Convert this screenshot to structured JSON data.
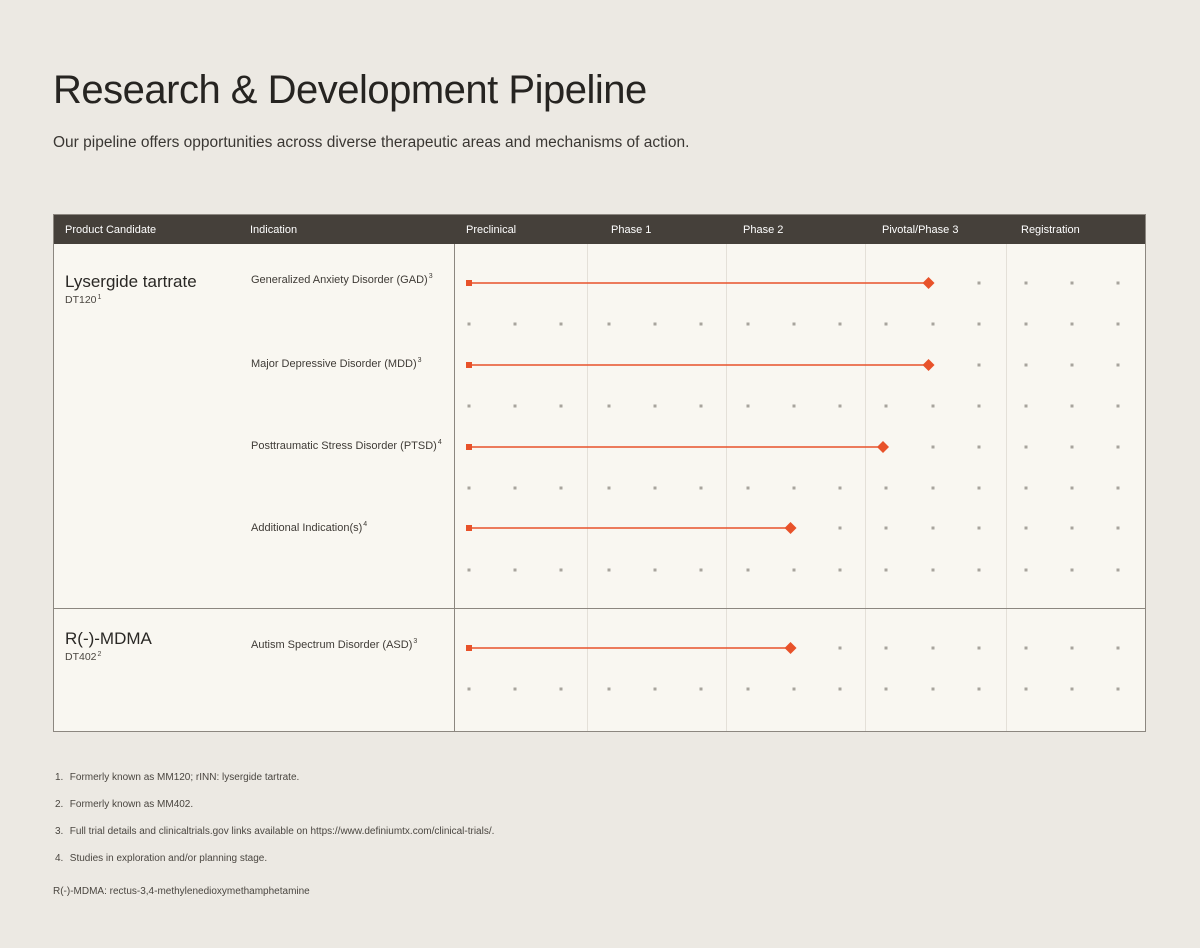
{
  "page": {
    "title": "Research & Development Pipeline",
    "subtitle": "Our pipeline offers opportunities across diverse therapeutic areas and mechanisms of action."
  },
  "table": {
    "header": {
      "product_candidate": "Product Candidate",
      "indication": "Indication",
      "preclinical": "Preclinical",
      "phase1": "Phase 1",
      "phase2": "Phase 2",
      "pivotal": "Pivotal/Phase 3",
      "registration": "Registration"
    },
    "candidates": [
      {
        "name": "Lysergide tartrate",
        "code": "DT120",
        "code_ref": "1",
        "indications": [
          {
            "label": "Generalized Anxiety Disorder (GAD)",
            "ref": "3"
          },
          {
            "label": "Major Depressive Disorder (MDD)",
            "ref": "3"
          },
          {
            "label": "Posttraumatic Stress Disorder (PTSD)",
            "ref": "4"
          },
          {
            "label": "Additional Indication(s)",
            "ref": "4"
          }
        ]
      },
      {
        "name": "R(-)-MDMA",
        "code": "DT402",
        "code_ref": "2",
        "indications": [
          {
            "label": "Autism Spectrum Disorder (ASD)",
            "ref": "3"
          }
        ]
      }
    ]
  },
  "chart_data": {
    "type": "bar",
    "orientation": "horizontal",
    "stages": [
      "Preclinical",
      "Phase 1",
      "Phase 2",
      "Pivotal/Phase 3",
      "Registration"
    ],
    "stage_subdivisions": 3,
    "note": "values are progress in stage units: 0 = start of Preclinical, 5 = end of Registration",
    "bars": [
      {
        "candidate": "Lysergide tartrate",
        "indication": "Generalized Anxiety Disorder (GAD)",
        "progress": 3.33
      },
      {
        "candidate": "Lysergide tartrate",
        "indication": "Major Depressive Disorder (MDD)",
        "progress": 3.33
      },
      {
        "candidate": "Lysergide tartrate",
        "indication": "Posttraumatic Stress Disorder (PTSD)",
        "progress": 3.0
      },
      {
        "candidate": "Lysergide tartrate",
        "indication": "Additional Indication(s)",
        "progress": 2.33
      },
      {
        "candidate": "R(-)-MDMA",
        "indication": "Autism Spectrum Disorder (ASD)",
        "progress": 2.33
      }
    ],
    "colors": {
      "bar": "#e8522a",
      "dot": "#a8a49d",
      "header": "#45403a"
    }
  },
  "footnotes": [
    {
      "num": "1.",
      "text": "Formerly known as MM120; rINN: lysergide tartrate."
    },
    {
      "num": "2.",
      "text": "Formerly known as MM402."
    },
    {
      "num": "3.",
      "text": "Full trial details and clinicaltrials.gov links available on https://www.definiumtx.com/clinical-trials/."
    },
    {
      "num": "4.",
      "text": "Studies in exploration and/or planning stage."
    }
  ],
  "abbreviation": "R(-)-MDMA: rectus-3,4-methylenedioxymethamphetamine"
}
